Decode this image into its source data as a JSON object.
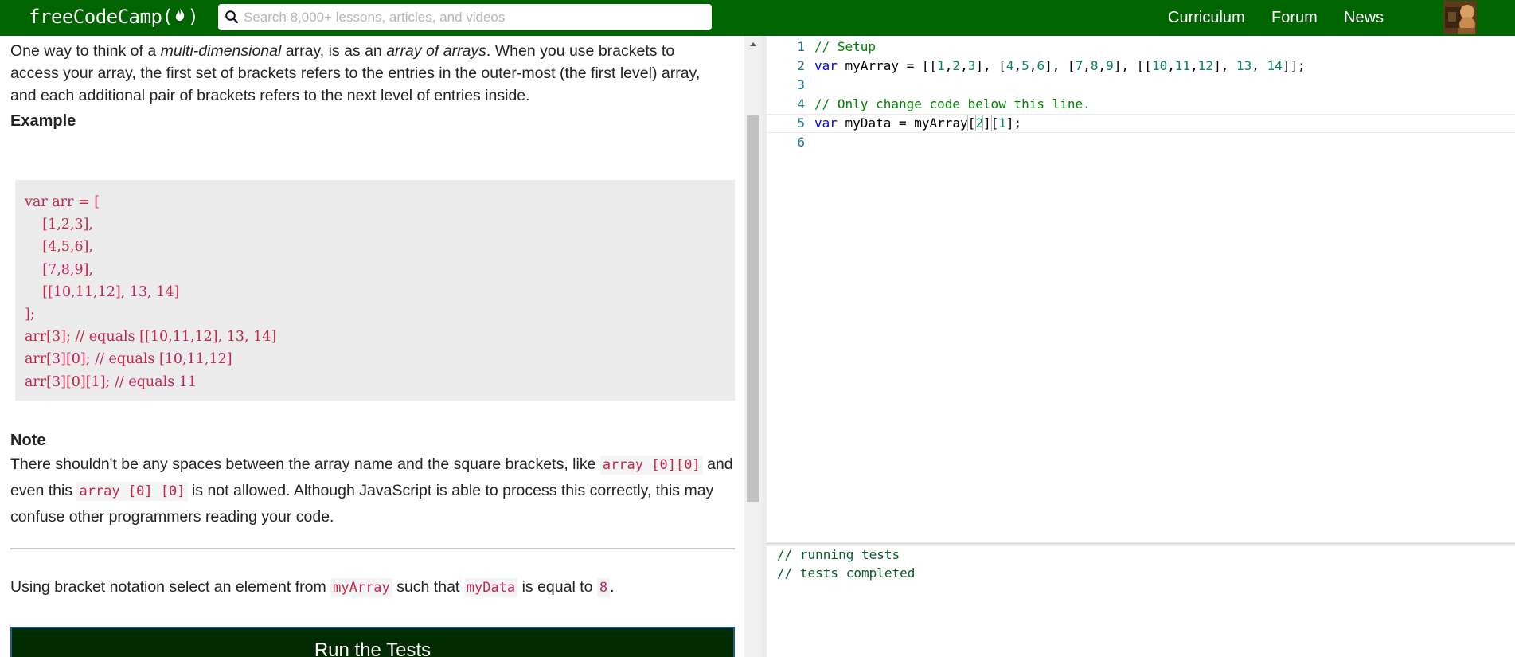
{
  "navbar": {
    "brand": "freeCodeCamp(🔥)",
    "brand_text": "freeCodeCamp(",
    "brand_close": ")",
    "search_placeholder": "Search 8,000+ lessons, articles, and videos",
    "links": [
      "Curriculum",
      "Forum",
      "News"
    ],
    "colors": {
      "bar": "#006400",
      "text": "#ffffff"
    },
    "icons": {
      "search": "search-icon",
      "flame": "flame-icon",
      "avatar": "user-avatar"
    }
  },
  "description": {
    "intro_parts": [
      "One way to think of a ",
      "multi-dimensional",
      " array, is as an ",
      "array of arrays",
      ". When you use brackets to access your array, the first set of brackets refers to the entries in the outer-most (the first level) array, and each additional pair of brackets refers to the next level of entries inside."
    ],
    "example_heading": "Example",
    "example_code": "var arr = [\n    [1,2,3],\n    [4,5,6],\n    [7,8,9],\n    [[10,11,12], 13, 14]\n];\narr[3]; // equals [[10,11,12], 13, 14]\narr[3][0]; // equals [10,11,12]\narr[3][0][1]; // equals 11",
    "note_heading": "Note",
    "note_parts": [
      "There shouldn't be any spaces between the array name and the square brackets, like ",
      "array [0][0]",
      " and even this ",
      "array [0] [0]",
      " is not allowed. Although JavaScript is able to process this correctly, this may confuse other programmers reading your code."
    ],
    "instruction_parts": [
      "Using bracket notation select an element from ",
      "myArray",
      " such that ",
      "myData",
      " is equal to ",
      "8",
      "."
    ],
    "run_button": "Run the Tests",
    "colors": {
      "code_text": "#c7254e",
      "code_bg": "#ececec",
      "run_bg": "#002a00"
    }
  },
  "editor": {
    "line_numbers": [
      "1",
      "2",
      "3",
      "4",
      "5",
      "6"
    ],
    "lines": [
      "// Setup",
      "var myArray = [[1,2,3], [4,5,6], [7,8,9], [[10,11,12], 13, 14]];",
      "",
      "// Only change code below this line.",
      "var myData = myArray[2][1];",
      ""
    ],
    "active_line": 5,
    "colors": {
      "comment": "#008000",
      "keyword": "#0000ff",
      "number": "#098658",
      "line_number": "#237893"
    }
  },
  "output": {
    "lines": [
      "// running tests",
      "// tests completed"
    ]
  }
}
